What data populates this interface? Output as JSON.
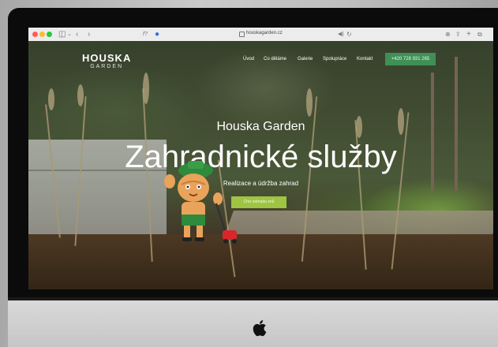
{
  "browser": {
    "url": "houskagarden.cz",
    "colors": {
      "close": "#ff5f57",
      "minimize": "#febc2e",
      "zoom": "#28c840"
    }
  },
  "site": {
    "logo_main": "HOUSKA",
    "logo_sub": "GARDEN",
    "nav": [
      "Úvod",
      "Co děláme",
      "Galerie",
      "Spolupráce",
      "Kontakt"
    ],
    "phone": "+420 728 931 265",
    "hero": {
      "eyebrow": "Houska Garden",
      "title": "Zahradnické služby",
      "subtitle": "Realizace a údržba zahrad",
      "cta": "Chci zahradu snů"
    },
    "accent": "#9ec441",
    "brand_green": "#3f8f57"
  }
}
